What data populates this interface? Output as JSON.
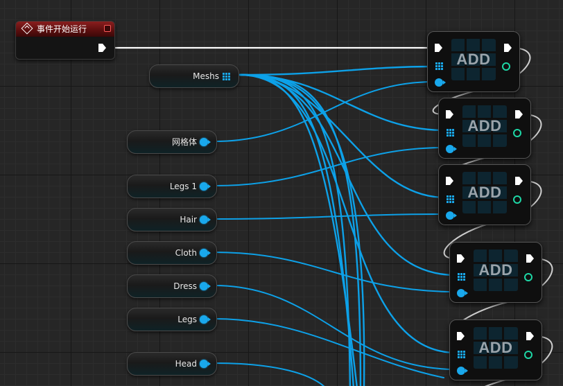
{
  "event_node": {
    "title": "事件开始运行"
  },
  "array_var": {
    "label": "Meshs"
  },
  "variables": [
    {
      "id": "wanggeti",
      "label": "网格体"
    },
    {
      "id": "legs1",
      "label": "Legs 1"
    },
    {
      "id": "hair",
      "label": "Hair"
    },
    {
      "id": "cloth",
      "label": "Cloth"
    },
    {
      "id": "dress",
      "label": "Dress"
    },
    {
      "id": "legs",
      "label": "Legs"
    },
    {
      "id": "head",
      "label": "Head"
    }
  ],
  "add_nodes": [
    {
      "label": "ADD"
    },
    {
      "label": "ADD"
    },
    {
      "label": "ADD"
    },
    {
      "label": "ADD"
    },
    {
      "label": "ADD"
    }
  ],
  "colors": {
    "object_wire": "#19a8ec",
    "exec_wire": "#ffffff",
    "integer_pin": "#1ed7a6",
    "event_header": "#8a1e1e"
  }
}
